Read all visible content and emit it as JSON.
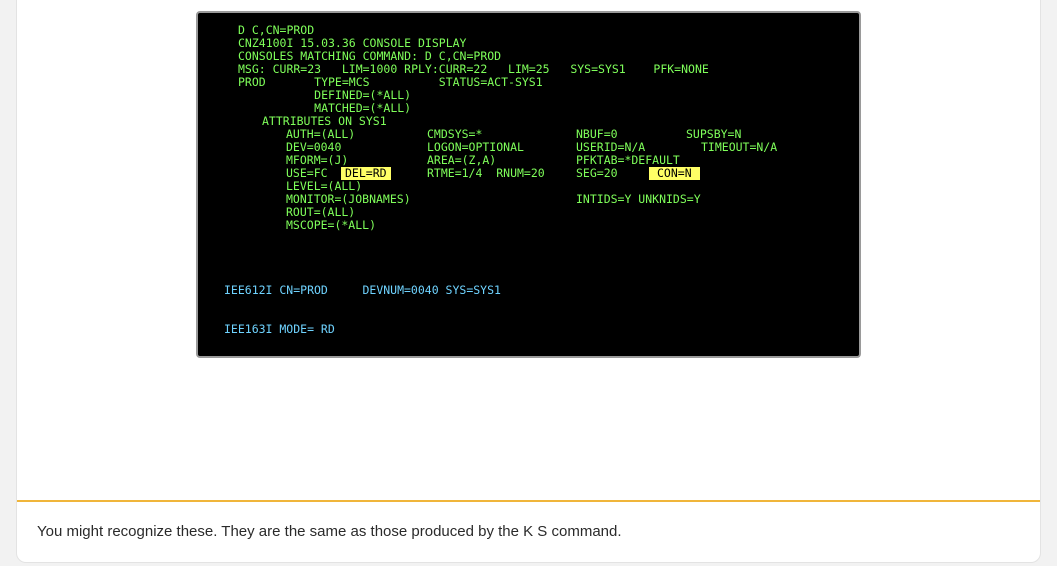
{
  "terminal": {
    "lines": [
      "D C,CN=PROD",
      "CNZ4100I 15.03.36 CONSOLE DISPLAY",
      "CONSOLES MATCHING COMMAND: D C,CN=PROD",
      "MSG: CURR=23   LIM=1000 RPLY:CURR=22   LIM=25   SYS=SYS1    PFK=NONE",
      "PROD       TYPE=MCS          STATUS=ACT-SYS1",
      "           DEFINED=(*ALL)",
      "           MATCHED=(*ALL)",
      "ATTRIBUTES ON SYS1"
    ],
    "col1": [
      "AUTH=(ALL)",
      "DEV=0040",
      "MFORM=(J)",
      "USE=FC",
      "LEVEL=(ALL)",
      "MONITOR=(JOBNAMES)",
      "ROUT=(ALL)",
      "MSCOPE=(*ALL)"
    ],
    "col2": [
      "CMDSYS=*",
      "LOGON=OPTIONAL",
      "AREA=(Z,A)",
      "RTME=1/4  RNUM=20"
    ],
    "col3": [
      "NBUF=0",
      "USERID=N/A",
      "PFKTAB=*DEFAULT",
      "SEG=20",
      "INTIDS=Y UNKNIDS=Y"
    ],
    "col4": [
      "SUPSBY=N",
      "TIMEOUT=N/A"
    ],
    "highlight_del": "DEL=RD",
    "highlight_con": "CON=N",
    "iee612": "IEE612I CN=PROD     DEVNUM=0040 SYS=SYS1",
    "iee163": "IEE163I MODE= RD"
  },
  "caption": "You might recognize these. They are the same as those produced by the K S command.",
  "colors": {
    "text_green": "#7fff5a",
    "text_cyan": "#6fd3ff",
    "highlight": "#ffff66",
    "divider": "#f0b53a"
  }
}
